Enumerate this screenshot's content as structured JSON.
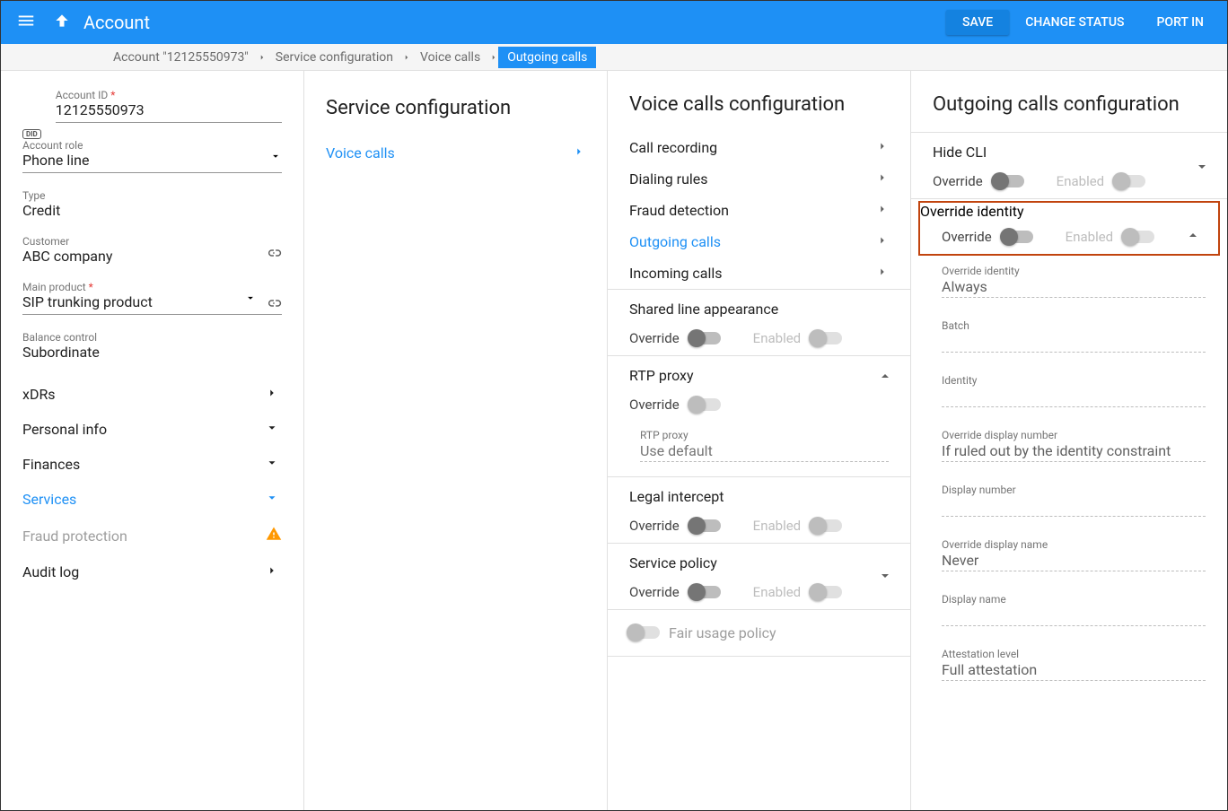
{
  "header": {
    "title": "Account",
    "save": "SAVE",
    "change_status": "CHANGE STATUS",
    "port_in": "PORT IN"
  },
  "breadcrumbs": {
    "b0": "Account \"12125550973\"",
    "b1": "Service configuration",
    "b2": "Voice calls",
    "b3": "Outgoing calls"
  },
  "account": {
    "id_label": "Account ID",
    "id": "12125550973",
    "role_label": "Account role",
    "role": "Phone line",
    "type_label": "Type",
    "type": "Credit",
    "customer_label": "Customer",
    "customer": "ABC company",
    "product_label": "Main product",
    "product": "SIP trunking product",
    "balance_label": "Balance control",
    "balance": "Subordinate"
  },
  "nav": {
    "xdrs": "xDRs",
    "personal": "Personal info",
    "finances": "Finances",
    "services": "Services",
    "fraud": "Fraud protection",
    "audit": "Audit log"
  },
  "svc": {
    "title": "Service configuration",
    "voice": "Voice calls"
  },
  "voice": {
    "title": "Voice calls configuration",
    "rec": "Call recording",
    "dial": "Dialing rules",
    "fraud": "Fraud detection",
    "out": "Outgoing calls",
    "in": "Incoming calls",
    "sla_h": "Shared line appearance",
    "rtp_h": "RTP proxy",
    "rtp_label": "RTP proxy",
    "rtp_value": "Use default",
    "legal_h": "Legal intercept",
    "policy_h": "Service policy",
    "fair": "Fair usage policy"
  },
  "lbl": {
    "override": "Override",
    "enabled": "Enabled"
  },
  "out": {
    "title": "Outgoing calls configuration",
    "hide_h": "Hide CLI",
    "ovid_h": "Override identity",
    "ovid_label": "Override identity",
    "ovid_value": "Always",
    "batch_label": "Batch",
    "batch_value": "",
    "identity_label": "Identity",
    "identity_value": "",
    "odn_label": "Override display number",
    "odn_value": "If ruled out by the identity constraint",
    "dn_label": "Display number",
    "dn_value": "",
    "odname_label": "Override display name",
    "odname_value": "Never",
    "dname_label": "Display name",
    "dname_value": "",
    "att_label": "Attestation level",
    "att_value": "Full attestation"
  },
  "did": "DID"
}
